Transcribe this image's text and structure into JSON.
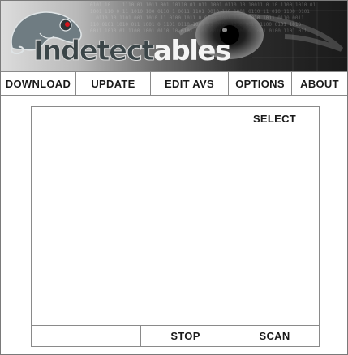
{
  "banner": {
    "logo_part_a": "Indetect",
    "logo_part_b": "ables",
    "icons": [
      "chameleon-logo-icon",
      "eye-icon"
    ],
    "colors": {
      "logo_dark": "#3b4548",
      "logo_light": "#f4f4f4",
      "chameleon_red": "#d8141c",
      "banner_dark": "#1a1a1a"
    }
  },
  "nav": {
    "items": [
      {
        "label": "DOWNLOAD"
      },
      {
        "label": "UPDATE"
      },
      {
        "label": "EDIT AVS"
      },
      {
        "label": "OPTIONS"
      },
      {
        "label": "ABOUT"
      }
    ]
  },
  "scanner": {
    "path_value": "",
    "select_label": "SELECT",
    "status_text": "",
    "stop_label": "STOP",
    "scan_label": "SCAN"
  }
}
